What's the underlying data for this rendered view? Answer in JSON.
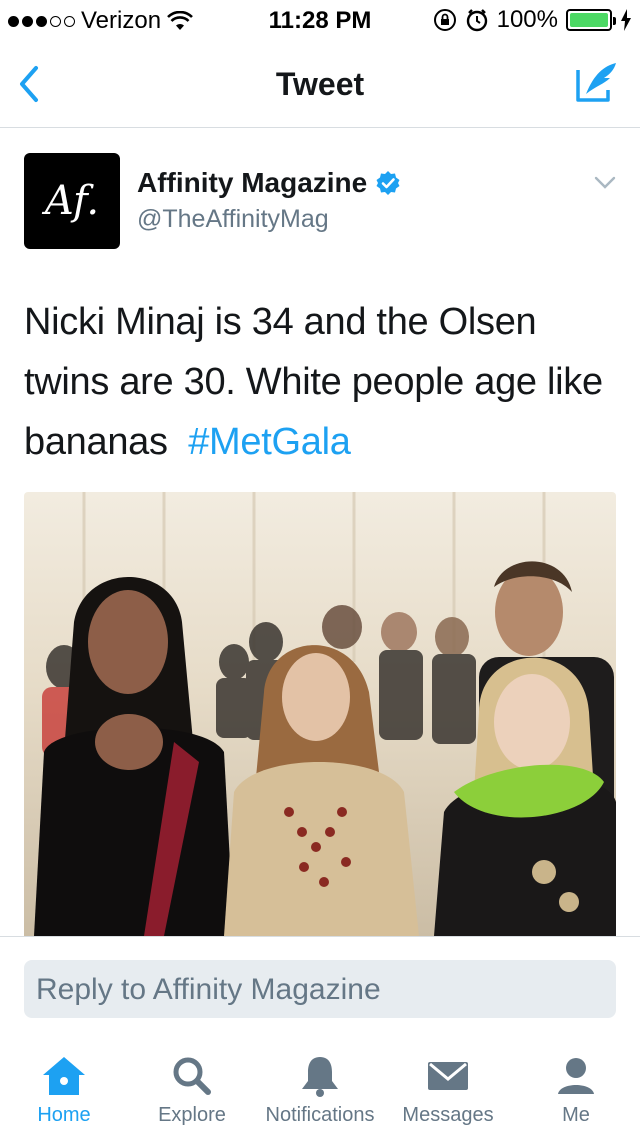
{
  "status_bar": {
    "carrier": "Verizon",
    "time": "11:28 PM",
    "battery": "100%",
    "signal_bars_full": 3,
    "signal_bars_total": 5
  },
  "nav": {
    "title": "Tweet"
  },
  "tweet": {
    "avatar_text": "Af.",
    "author_name": "Affinity Magazine",
    "author_handle": "@TheAffinityMag",
    "text": "Nicki Minaj is 34 and the Olsen twins are 30. White people age like bananas",
    "hashtag": "#MetGala"
  },
  "reply": {
    "placeholder": "Reply to Affinity Magazine"
  },
  "tabs": [
    {
      "label": "Home",
      "icon": "home-icon",
      "active": true
    },
    {
      "label": "Explore",
      "icon": "search-icon",
      "active": false
    },
    {
      "label": "Notifications",
      "icon": "bell-icon",
      "active": false
    },
    {
      "label": "Messages",
      "icon": "envelope-icon",
      "active": false
    },
    {
      "label": "Me",
      "icon": "person-icon",
      "active": false
    }
  ],
  "colors": {
    "accent": "#1da1f2",
    "secondary_text": "#657786",
    "battery": "#4cd964"
  }
}
